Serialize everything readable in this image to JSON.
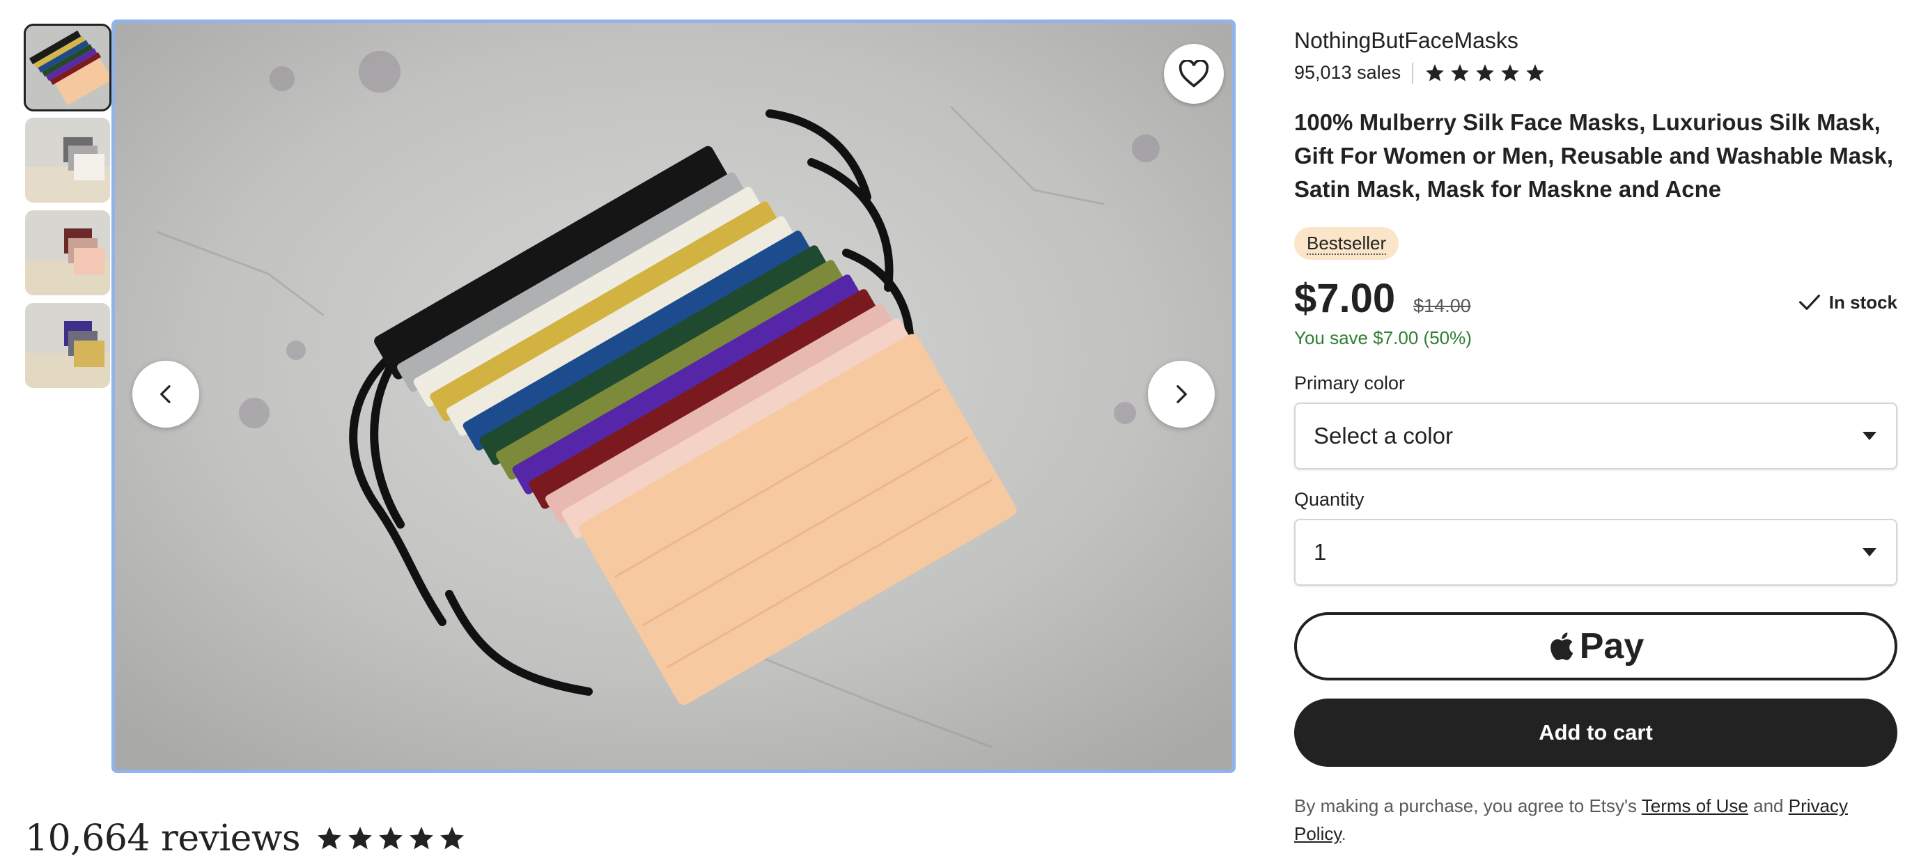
{
  "gallery": {
    "thumbnails": [
      {
        "alt": "Silk masks fanned out"
      },
      {
        "alt": "Grey and white masks"
      },
      {
        "alt": "Pink and brown masks"
      },
      {
        "alt": "Purple and gold masks"
      }
    ],
    "favorite_icon": "heart-outline-icon",
    "prev_icon": "chevron-left-icon",
    "next_icon": "chevron-right-icon"
  },
  "reviews": {
    "count_label": "10,664 reviews",
    "rating_stars": 5
  },
  "shop": {
    "name": "NothingButFaceMasks",
    "sales": "95,013 sales",
    "rating_stars": 5
  },
  "product": {
    "title": "100% Mulberry Silk Face Masks, Luxurious Silk Mask, Gift For Women or Men, Reusable and Washable Mask, Satin Mask, Mask for Maskne and Acne",
    "badge": "Bestseller",
    "price": "$7.00",
    "original_price": "$14.00",
    "savings": "You save $7.00 (50%)",
    "stock": "In stock"
  },
  "options": {
    "color_label": "Primary color",
    "color_value": "Select a color",
    "quantity_label": "Quantity",
    "quantity_value": "1"
  },
  "actions": {
    "apple_pay_label": "Pay",
    "add_to_cart": "Add to cart"
  },
  "legal": {
    "prefix": "By making a purchase, you agree to Etsy's ",
    "terms": "Terms of Use",
    "and": " and ",
    "privacy": "Privacy Policy",
    "suffix": "."
  },
  "colors": {
    "accent_dark": "#222222",
    "badge_bg": "#fbe5c9",
    "savings_green": "#2f7d32",
    "focus_ring": "#8fb4ec"
  }
}
